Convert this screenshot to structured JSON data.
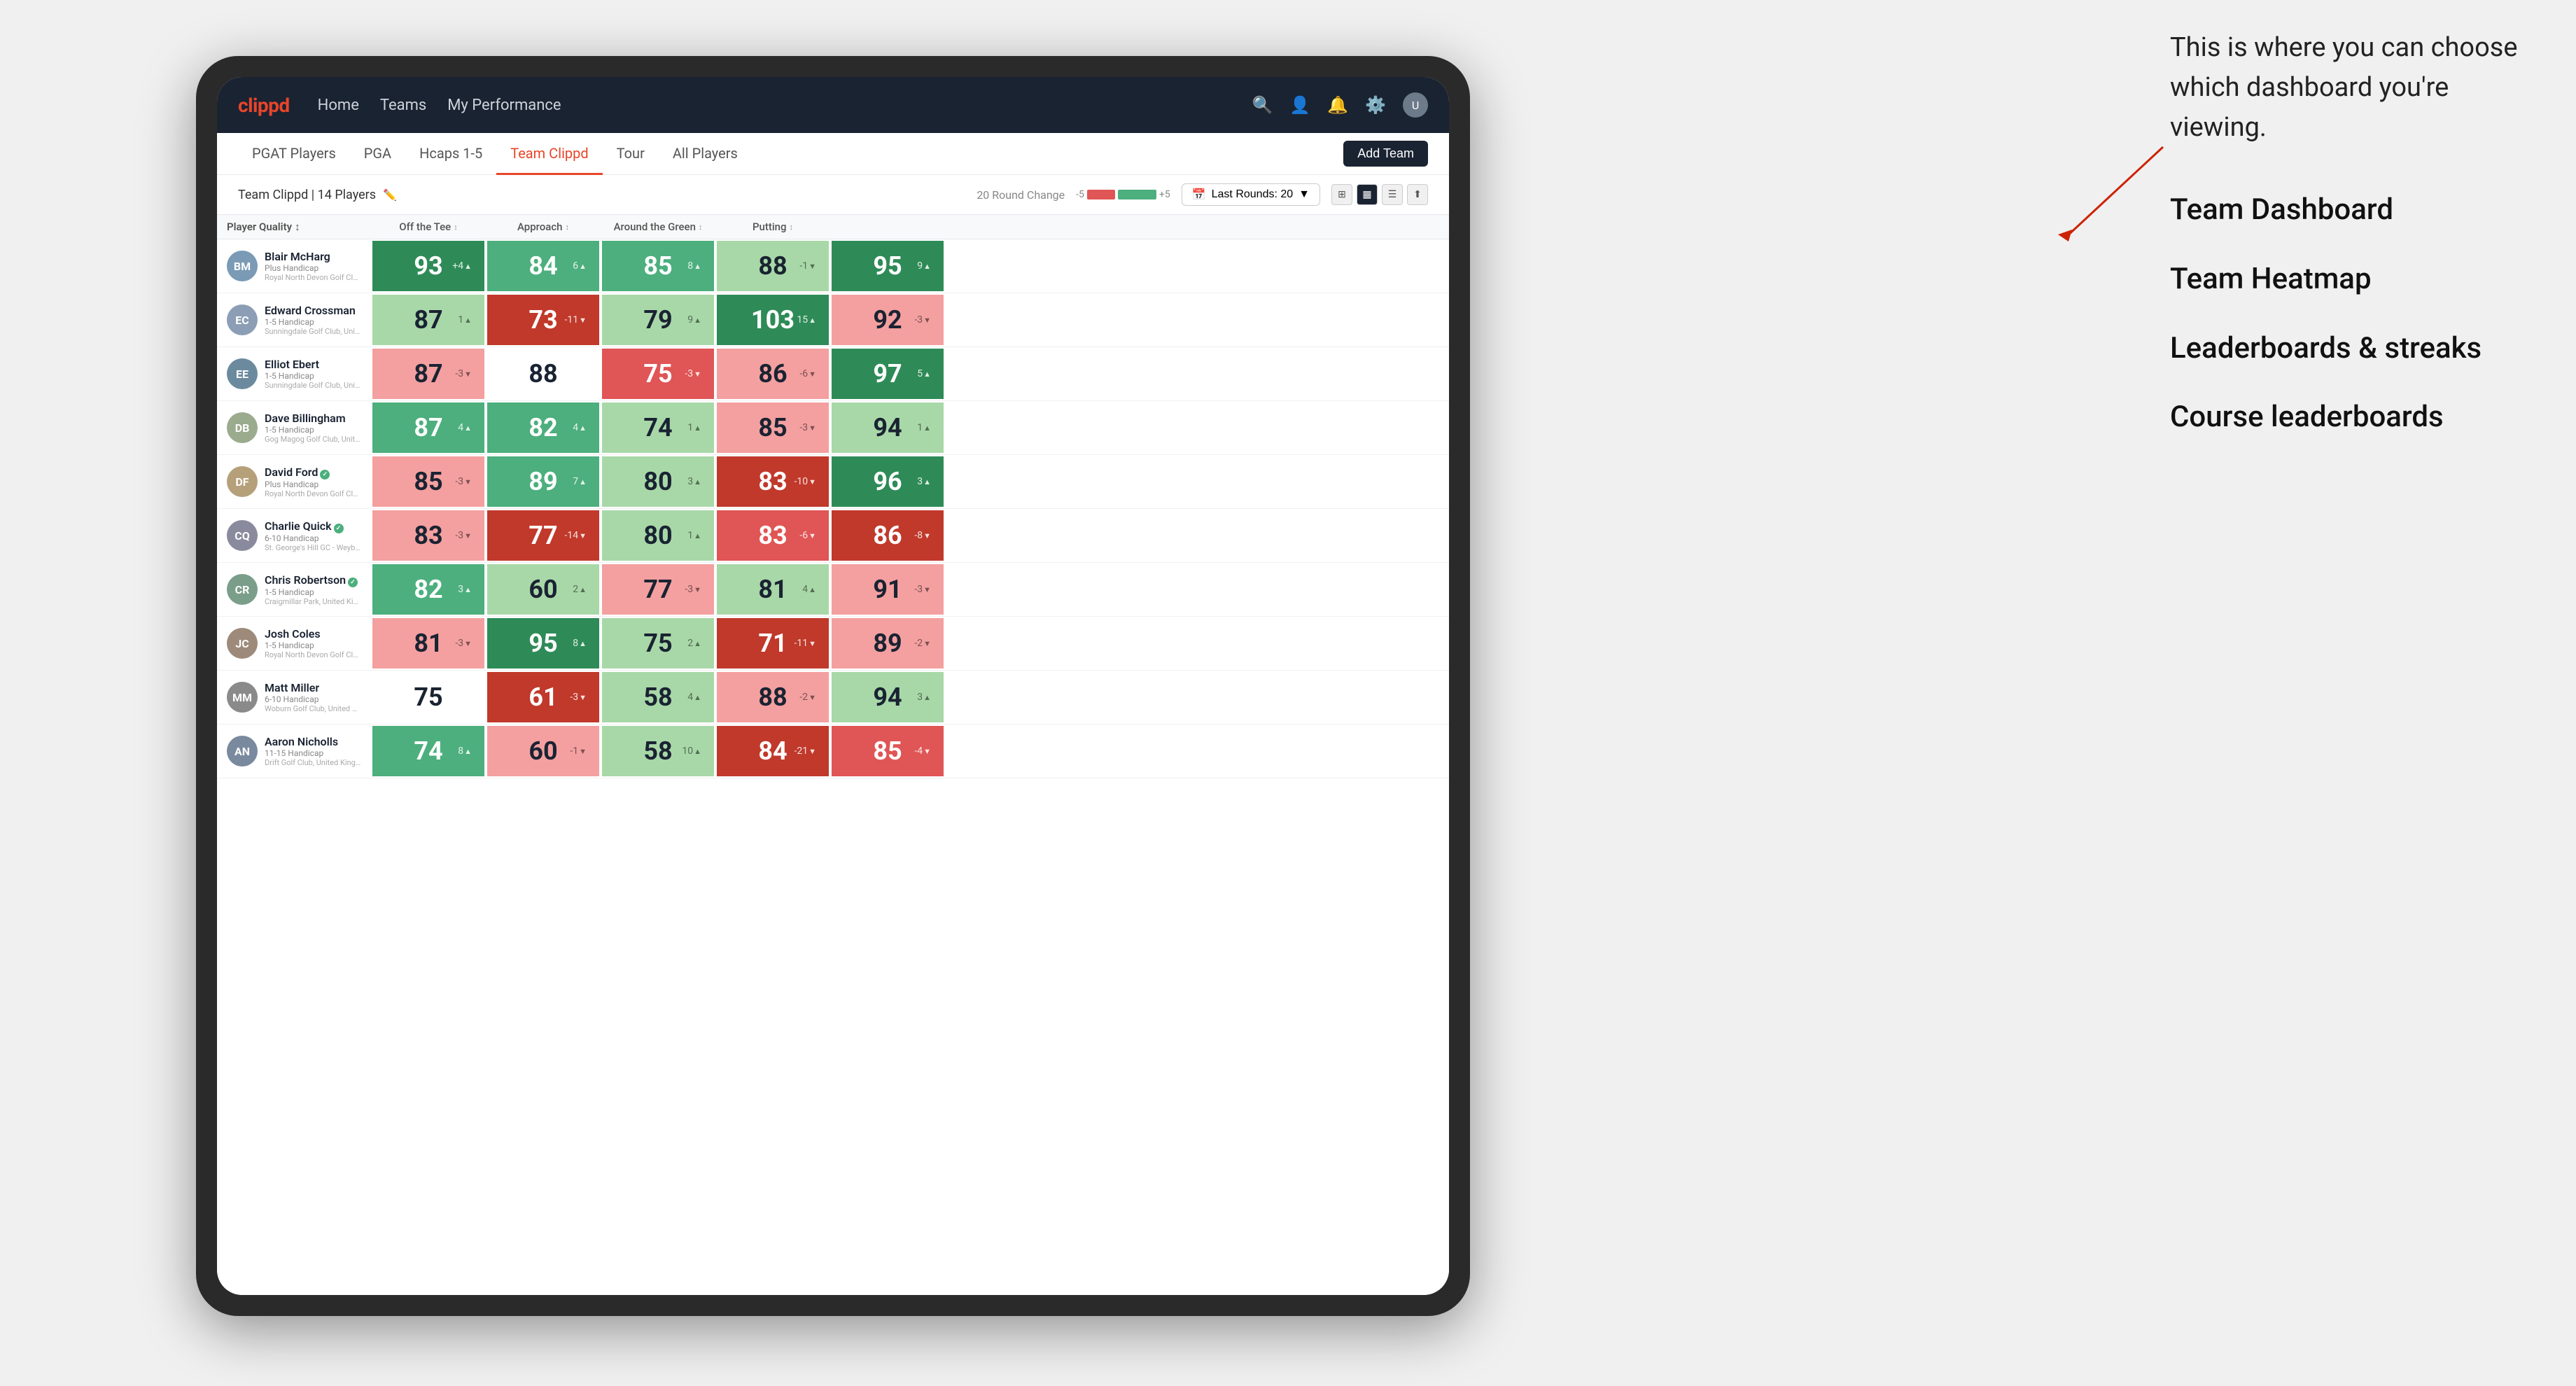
{
  "annotation": {
    "intro": "This is where you can choose which dashboard you're viewing.",
    "items": [
      "Team Dashboard",
      "Team Heatmap",
      "Leaderboards & streaks",
      "Course leaderboards"
    ]
  },
  "navbar": {
    "logo": "clippd",
    "nav_items": [
      "Home",
      "Teams",
      "My Performance"
    ],
    "icons": [
      "search",
      "person",
      "bell",
      "settings",
      "avatar"
    ]
  },
  "subnav": {
    "items": [
      "PGAT Players",
      "PGA",
      "Hcaps 1-5",
      "Team Clippd",
      "Tour",
      "All Players"
    ],
    "active": "Team Clippd",
    "add_team_label": "Add Team"
  },
  "team_header": {
    "team_name": "Team Clippd",
    "player_count": "14 Players",
    "round_change_label": "20 Round Change",
    "range_min": "-5",
    "range_max": "+5",
    "last_rounds_label": "Last Rounds: 20"
  },
  "table": {
    "columns": {
      "player_quality": "Player Quality",
      "off_tee": "Off the Tee",
      "approach": "Approach",
      "around_green": "Around the Green",
      "putting": "Putting"
    },
    "players": [
      {
        "name": "Blair McHarg",
        "handicap": "Plus Handicap",
        "club": "Royal North Devon Golf Club, United Kingdom",
        "avatar_initials": "BM",
        "avatar_color": "#7a9ab5",
        "scores": {
          "player_quality": {
            "value": 93,
            "change": "+4",
            "direction": "up",
            "color": "green-dark"
          },
          "off_tee": {
            "value": 84,
            "change": "6",
            "direction": "up",
            "color": "green-mid"
          },
          "approach": {
            "value": 85,
            "change": "8",
            "direction": "up",
            "color": "green-mid"
          },
          "around_green": {
            "value": 88,
            "change": "-1",
            "direction": "down",
            "color": "green-light"
          },
          "putting": {
            "value": 95,
            "change": "9",
            "direction": "up",
            "color": "green-dark"
          }
        }
      },
      {
        "name": "Edward Crossman",
        "handicap": "1-5 Handicap",
        "club": "Sunningdale Golf Club, United Kingdom",
        "avatar_initials": "EC",
        "avatar_color": "#8b9eb5",
        "scores": {
          "player_quality": {
            "value": 87,
            "change": "1",
            "direction": "up",
            "color": "green-light"
          },
          "off_tee": {
            "value": 73,
            "change": "-11",
            "direction": "down",
            "color": "red-dark"
          },
          "approach": {
            "value": 79,
            "change": "9",
            "direction": "up",
            "color": "green-light"
          },
          "around_green": {
            "value": 103,
            "change": "15",
            "direction": "up",
            "color": "green-dark"
          },
          "putting": {
            "value": 92,
            "change": "-3",
            "direction": "down",
            "color": "red-light"
          }
        }
      },
      {
        "name": "Elliot Ebert",
        "handicap": "1-5 Handicap",
        "club": "Sunningdale Golf Club, United Kingdom",
        "avatar_initials": "EE",
        "avatar_color": "#6b8a9e",
        "scores": {
          "player_quality": {
            "value": 87,
            "change": "-3",
            "direction": "down",
            "color": "red-light"
          },
          "off_tee": {
            "value": 88,
            "change": "",
            "direction": "",
            "color": "white"
          },
          "approach": {
            "value": 75,
            "change": "-3",
            "direction": "down",
            "color": "red-mid"
          },
          "around_green": {
            "value": 86,
            "change": "-6",
            "direction": "down",
            "color": "red-light"
          },
          "putting": {
            "value": 97,
            "change": "5",
            "direction": "up",
            "color": "green-dark"
          }
        }
      },
      {
        "name": "Dave Billingham",
        "handicap": "1-5 Handicap",
        "club": "Gog Magog Golf Club, United Kingdom",
        "avatar_initials": "DB",
        "avatar_color": "#9aab8e",
        "scores": {
          "player_quality": {
            "value": 87,
            "change": "4",
            "direction": "up",
            "color": "green-mid"
          },
          "off_tee": {
            "value": 82,
            "change": "4",
            "direction": "up",
            "color": "green-mid"
          },
          "approach": {
            "value": 74,
            "change": "1",
            "direction": "up",
            "color": "green-light"
          },
          "around_green": {
            "value": 85,
            "change": "-3",
            "direction": "down",
            "color": "red-light"
          },
          "putting": {
            "value": 94,
            "change": "1",
            "direction": "up",
            "color": "green-light"
          }
        }
      },
      {
        "name": "David Ford",
        "handicap": "Plus Handicap",
        "club": "Royal North Devon Golf Club, United Kingdom",
        "avatar_initials": "DF",
        "avatar_color": "#b5a07a",
        "verified": true,
        "scores": {
          "player_quality": {
            "value": 85,
            "change": "-3",
            "direction": "down",
            "color": "red-light"
          },
          "off_tee": {
            "value": 89,
            "change": "7",
            "direction": "up",
            "color": "green-mid"
          },
          "approach": {
            "value": 80,
            "change": "3",
            "direction": "up",
            "color": "green-light"
          },
          "around_green": {
            "value": 83,
            "change": "-10",
            "direction": "down",
            "color": "red-dark"
          },
          "putting": {
            "value": 96,
            "change": "3",
            "direction": "up",
            "color": "green-dark"
          }
        }
      },
      {
        "name": "Charlie Quick",
        "handicap": "6-10 Handicap",
        "club": "St. George's Hill GC - Weybridge - Surrey, Uni...",
        "avatar_initials": "CQ",
        "avatar_color": "#8a8a9e",
        "verified": true,
        "scores": {
          "player_quality": {
            "value": 83,
            "change": "-3",
            "direction": "down",
            "color": "red-light"
          },
          "off_tee": {
            "value": 77,
            "change": "-14",
            "direction": "down",
            "color": "red-dark"
          },
          "approach": {
            "value": 80,
            "change": "1",
            "direction": "up",
            "color": "green-light"
          },
          "around_green": {
            "value": 83,
            "change": "-6",
            "direction": "down",
            "color": "red-mid"
          },
          "putting": {
            "value": 86,
            "change": "-8",
            "direction": "down",
            "color": "red-dark"
          }
        }
      },
      {
        "name": "Chris Robertson",
        "handicap": "1-5 Handicap",
        "club": "Craigmillar Park, United Kingdom",
        "avatar_initials": "CR",
        "avatar_color": "#7a9e8a",
        "verified": true,
        "scores": {
          "player_quality": {
            "value": 82,
            "change": "3",
            "direction": "up",
            "color": "green-mid"
          },
          "off_tee": {
            "value": 60,
            "change": "2",
            "direction": "up",
            "color": "green-light"
          },
          "approach": {
            "value": 77,
            "change": "-3",
            "direction": "down",
            "color": "red-light"
          },
          "around_green": {
            "value": 81,
            "change": "4",
            "direction": "up",
            "color": "green-light"
          },
          "putting": {
            "value": 91,
            "change": "-3",
            "direction": "down",
            "color": "red-light"
          }
        }
      },
      {
        "name": "Josh Coles",
        "handicap": "1-5 Handicap",
        "club": "Royal North Devon Golf Club, United Kingdom",
        "avatar_initials": "JC",
        "avatar_color": "#9e8a7a",
        "scores": {
          "player_quality": {
            "value": 81,
            "change": "-3",
            "direction": "down",
            "color": "red-light"
          },
          "off_tee": {
            "value": 95,
            "change": "8",
            "direction": "up",
            "color": "green-dark"
          },
          "approach": {
            "value": 75,
            "change": "2",
            "direction": "up",
            "color": "green-light"
          },
          "around_green": {
            "value": 71,
            "change": "-11",
            "direction": "down",
            "color": "red-dark"
          },
          "putting": {
            "value": 89,
            "change": "-2",
            "direction": "down",
            "color": "red-light"
          }
        }
      },
      {
        "name": "Matt Miller",
        "handicap": "6-10 Handicap",
        "club": "Woburn Golf Club, United Kingdom",
        "avatar_initials": "MM",
        "avatar_color": "#8a8a8a",
        "scores": {
          "player_quality": {
            "value": 75,
            "change": "",
            "direction": "",
            "color": "white"
          },
          "off_tee": {
            "value": 61,
            "change": "-3",
            "direction": "down",
            "color": "red-dark"
          },
          "approach": {
            "value": 58,
            "change": "4",
            "direction": "up",
            "color": "green-light"
          },
          "around_green": {
            "value": 88,
            "change": "-2",
            "direction": "down",
            "color": "red-light"
          },
          "putting": {
            "value": 94,
            "change": "3",
            "direction": "up",
            "color": "green-light"
          }
        }
      },
      {
        "name": "Aaron Nicholls",
        "handicap": "11-15 Handicap",
        "club": "Drift Golf Club, United Kingdom",
        "avatar_initials": "AN",
        "avatar_color": "#7a8a9e",
        "scores": {
          "player_quality": {
            "value": 74,
            "change": "8",
            "direction": "up",
            "color": "green-mid"
          },
          "off_tee": {
            "value": 60,
            "change": "-1",
            "direction": "down",
            "color": "red-light"
          },
          "approach": {
            "value": 58,
            "change": "10",
            "direction": "up",
            "color": "green-light"
          },
          "around_green": {
            "value": 84,
            "change": "-21",
            "direction": "down",
            "color": "red-dark"
          },
          "putting": {
            "value": 85,
            "change": "-4",
            "direction": "down",
            "color": "red-mid"
          }
        }
      }
    ]
  }
}
